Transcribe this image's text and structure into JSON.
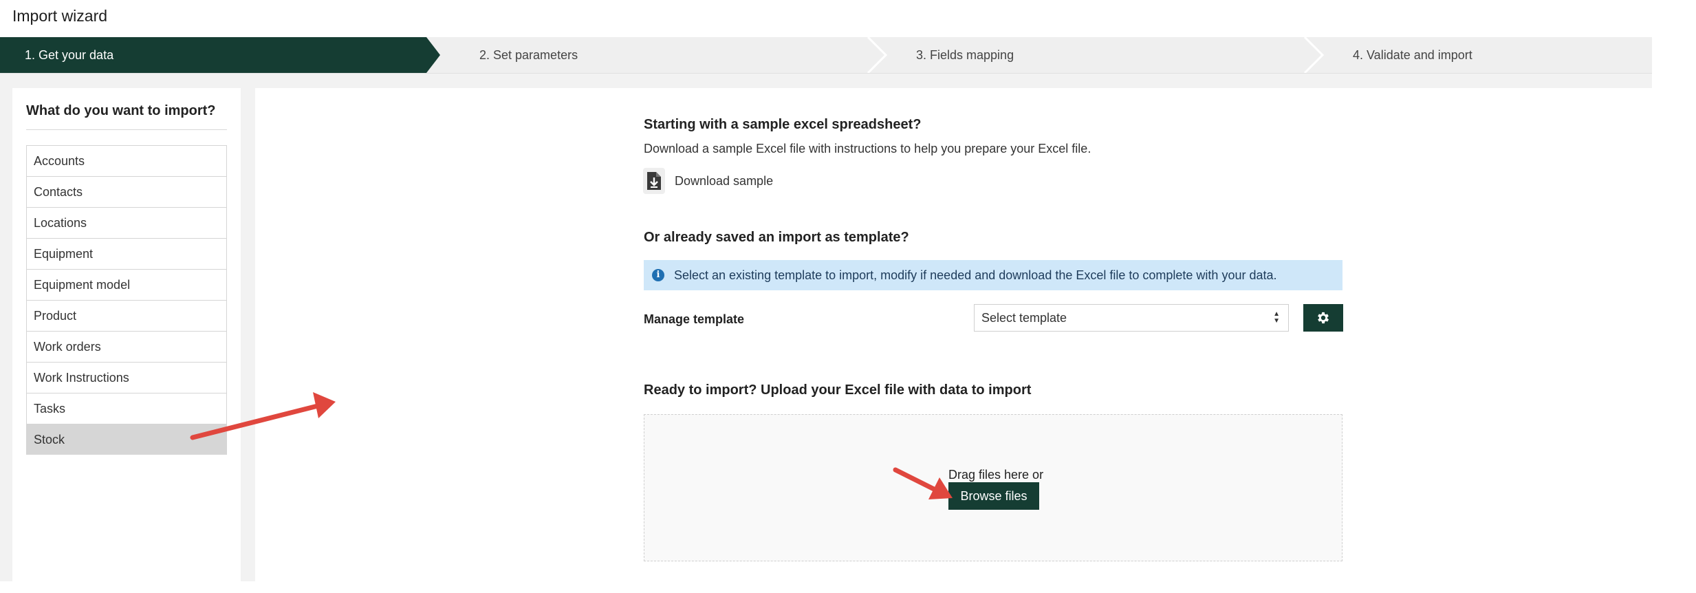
{
  "app": {
    "title": "Import wizard"
  },
  "stepper": {
    "steps": [
      {
        "label": "1. Get your data"
      },
      {
        "label": "2. Set parameters"
      },
      {
        "label": "3. Fields mapping"
      },
      {
        "label": "4. Validate and import"
      }
    ],
    "active_step": 1
  },
  "sidebar": {
    "heading": "What do you want to import?",
    "items": [
      {
        "label": "Accounts"
      },
      {
        "label": "Contacts"
      },
      {
        "label": "Locations"
      },
      {
        "label": "Equipment"
      },
      {
        "label": "Equipment model"
      },
      {
        "label": "Product"
      },
      {
        "label": "Work orders"
      },
      {
        "label": "Work Instructions"
      },
      {
        "label": "Tasks"
      },
      {
        "label": "Stock"
      }
    ],
    "selected": "Stock"
  },
  "sample": {
    "title": "Starting with a sample excel spreadsheet?",
    "description": "Download a sample Excel file with instructions to help you prepare your Excel file.",
    "download_label": "Download sample",
    "icon": "file-download-icon"
  },
  "template": {
    "title": "Or already saved an import as template?",
    "info_text": "Select an existing template to import, modify if needed and download the Excel file to complete with your data.",
    "manage_label": "Manage template",
    "select_value": "Select template",
    "settings_icon": "gear-icon"
  },
  "upload": {
    "title": "Ready to import? Upload your Excel file with data to import",
    "drag_text": "Drag files here or",
    "browse_label": "Browse files"
  },
  "colors": {
    "brand": "#153d33",
    "info_bg": "#cfe7f9",
    "annotation_arrow": "#e0473e"
  }
}
